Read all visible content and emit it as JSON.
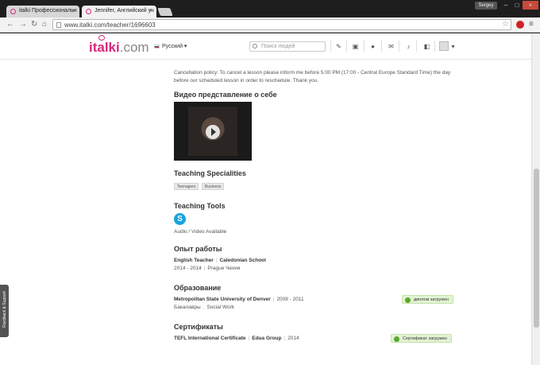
{
  "browser": {
    "tabs": [
      {
        "title": "italki Профессиональн"
      },
      {
        "title": "Jennifer, Английский уч"
      }
    ],
    "user": "Sergey",
    "url": "www.italki.com/teacher/1696603"
  },
  "header": {
    "logo": "italki",
    "logo_suffix": ".com",
    "language": "Русский",
    "search_placeholder": "Поиск людей"
  },
  "policy": "Cancellation policy: To cancel a lesson please inform me before 5:00 PM (17:00 - Central Europe Standard Time) the day before our scheduled lesson in order to reschedule. Thank you.",
  "video_section": {
    "title": "Видео представление о себе"
  },
  "specialities": {
    "title": "Teaching Specialities",
    "tags": [
      "Teenagers",
      "Business"
    ]
  },
  "tools": {
    "title": "Teaching Tools",
    "label": "Audio / Video Available"
  },
  "experience": {
    "title": "Опыт работы",
    "role": "English Teacher",
    "org": "Caledonian School",
    "years": "2014 - 2014",
    "location": "Prague Чехия"
  },
  "education": {
    "title": "Образование",
    "school": "Metropolitan State University of Denver",
    "years": "2008 - 2011",
    "degree": "Бакалавры",
    "field": "Social Work",
    "badge": "диплом загружен"
  },
  "certificates": {
    "title": "Сертификаты",
    "name": "TEFL International Certificate",
    "org": "Edua Group",
    "year": "2014",
    "badge": "Сертификат загружен"
  },
  "feedback": "Feedback & Support"
}
